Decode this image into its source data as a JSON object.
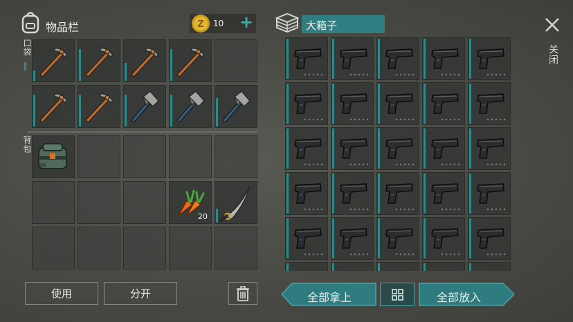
{
  "inventory": {
    "title": "物品栏",
    "coins": "10",
    "pocket_label": "口袋",
    "backpack_label": "背包"
  },
  "chest": {
    "title": "大箱子"
  },
  "close_label": "关闭",
  "buttons": {
    "use": "使用",
    "split": "分开",
    "take_all": "全部拿上",
    "put_all": "全部放入"
  },
  "pocket_items": [
    "pickaxe",
    "pickaxe",
    "pickaxe",
    "pickaxe",
    "",
    "pickaxe",
    "pickaxe",
    "hammer",
    "hammer",
    "hammer"
  ],
  "pocket_durability": [
    0.25,
    0.8,
    0.45,
    0.8,
    0,
    0.8,
    0.8,
    0.8,
    0.8,
    0.7
  ],
  "backpack_items": [
    {
      "type": "backpack"
    },
    {
      "type": ""
    },
    {
      "type": ""
    },
    {
      "type": ""
    },
    {
      "type": ""
    },
    {
      "type": ""
    },
    {
      "type": ""
    },
    {
      "type": ""
    },
    {
      "type": "carrot",
      "count": "20"
    },
    {
      "type": "sword"
    },
    {
      "type": ""
    },
    {
      "type": ""
    },
    {
      "type": ""
    },
    {
      "type": ""
    },
    {
      "type": ""
    }
  ],
  "chest_item": "pistol",
  "colors": {
    "accent": "#2f7f82",
    "panel": "#343634",
    "teal_button": "#2e7c80"
  }
}
